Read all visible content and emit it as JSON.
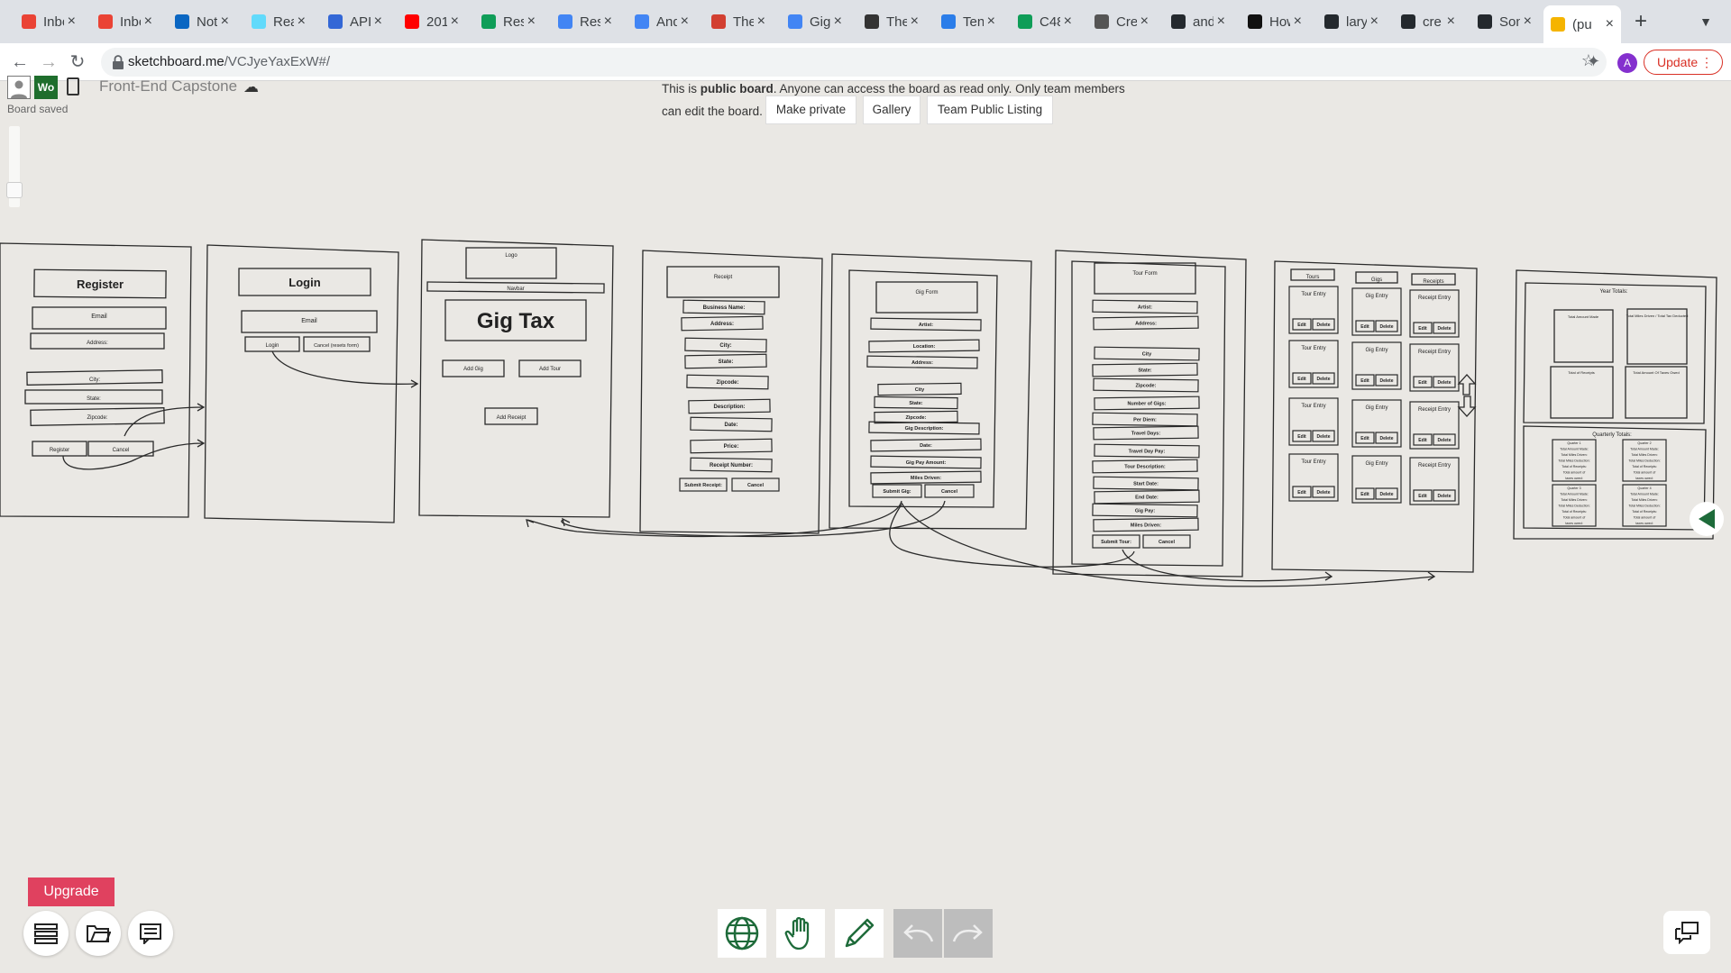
{
  "tabs": [
    {
      "title": "Inbox",
      "favicon": "gmail-icon",
      "color": "#ea4335"
    },
    {
      "title": "Inbox",
      "favicon": "gmail-icon",
      "color": "#ea4335"
    },
    {
      "title": "Noti",
      "favicon": "linkedin-icon",
      "color": "#0a66c2"
    },
    {
      "title": "Rea",
      "favicon": "react-icon",
      "color": "#61dafb"
    },
    {
      "title": "API",
      "favicon": "api-icon",
      "color": "#3367d6"
    },
    {
      "title": "201",
      "favicon": "youtube-icon",
      "color": "#ff0000"
    },
    {
      "title": "Res",
      "favicon": "drive-icon",
      "color": "#0f9d58"
    },
    {
      "title": "Res",
      "favicon": "docs-icon",
      "color": "#4285f4"
    },
    {
      "title": "And",
      "favicon": "docs-icon",
      "color": "#4285f4"
    },
    {
      "title": "The",
      "favicon": "flame-icon",
      "color": "#d23f31"
    },
    {
      "title": "Gig",
      "favicon": "docs-icon",
      "color": "#4285f4"
    },
    {
      "title": "The",
      "favicon": "book-icon",
      "color": "#333333"
    },
    {
      "title": "Ten",
      "favicon": "c-icon",
      "color": "#2b7de9"
    },
    {
      "title": "C48",
      "favicon": "drive-icon",
      "color": "#0f9d58"
    },
    {
      "title": "Cre",
      "favicon": "globe-icon",
      "color": "#555555"
    },
    {
      "title": "and",
      "favicon": "github-icon",
      "color": "#24292e"
    },
    {
      "title": "How",
      "favicon": "lambda-icon",
      "color": "#111111"
    },
    {
      "title": "lary",
      "favicon": "github-icon",
      "color": "#24292e"
    },
    {
      "title": "cre",
      "favicon": "github-icon",
      "color": "#24292e"
    },
    {
      "title": "Son",
      "favicon": "github-icon",
      "color": "#24292e"
    },
    {
      "title": "(pu",
      "favicon": "sketchboard-icon",
      "color": "#f5b400",
      "active": true
    }
  ],
  "browser": {
    "url_domain": "sketchboard.me",
    "url_path": "/VCJyeYaxExW#/",
    "update_label": "Update",
    "profile_initial": "A"
  },
  "app": {
    "workspace_badge": "Wo",
    "board_title": "Front-End Capstone",
    "saved_status": "Board saved",
    "notice_bold": "public board",
    "notice_pre": "This is ",
    "notice_post": ". Anyone can access the board as read only. Only team members can edit the board.",
    "make_private": "Make private",
    "gallery": "Gallery",
    "team_listing": "Team Public Listing",
    "upgrade": "Upgrade"
  },
  "wireframes": {
    "register": {
      "title": "Register",
      "fields": [
        "Email",
        "Address:",
        "City:",
        "State:",
        "Zipcode:"
      ],
      "buttons": [
        "Register",
        "Cancel"
      ]
    },
    "login": {
      "title": "Login",
      "fields": [
        "Email"
      ],
      "buttons": [
        "Login",
        "Cancel (resets form)"
      ]
    },
    "home": {
      "logo": "Logo",
      "navbar": "Navbar",
      "title": "Gig Tax",
      "buttons": [
        "Add Gig",
        "Add Tour",
        "Add Receipt"
      ]
    },
    "receipt": {
      "title": "Receipt",
      "fields": [
        "Business Name:",
        "Address:",
        "City:",
        "State:",
        "Zipcode:",
        "Description:",
        "Date:",
        "Price:",
        "Receipt Number:"
      ],
      "buttons": [
        "Submit Receipt:",
        "Cancel"
      ]
    },
    "gig_form": {
      "title": "Gig Form",
      "fields": [
        "Artist:",
        "Location:",
        "Address:",
        "City",
        "State:",
        "Zipcode:",
        "Gig Description:",
        "Date:",
        "Gig Pay Amount:",
        "Miles Driven:"
      ],
      "buttons": [
        "Submit Gig:",
        "Cancel"
      ]
    },
    "tour_form": {
      "title": "Tour Form",
      "fields": [
        "Artist:",
        "Address:",
        "City",
        "State:",
        "Zipcode:",
        "Number of Gigs:",
        "Per Diem:",
        "Travel Days:",
        "Travel Day Pay:",
        "Tour Description:",
        "Start Date:",
        "End Date:",
        "Gig Pay:",
        "Miles Driven:"
      ],
      "buttons": [
        "Submit Tour:",
        "Cancel"
      ]
    },
    "list": {
      "tabs": [
        "Tours",
        "Gigs",
        "Receipts"
      ],
      "columns": [
        "Tour Entry",
        "Gig Entry",
        "Receipt Entry"
      ],
      "edit": "Edit",
      "delete": "Delete"
    },
    "totals": {
      "title": "Year Totals:",
      "boxes": [
        "Total Amount Made",
        "Total Miles Driven / Total Tax Deducted",
        "Total of Receipts",
        "Total Amount Of Taxes Owed"
      ],
      "quarterly_title": "Quarterly Totals:",
      "quarters": [
        "Quarter 1",
        "Quarter 2",
        "Quarter 3",
        "Quarter 4"
      ],
      "quarter_lines": [
        "Total Amount Made:",
        "Total Miles Driven:",
        "Total Miles Deduction:",
        "Total of Receipts:",
        "Total amount of",
        "taxes owed:"
      ]
    }
  },
  "tools": {
    "globe": "globe-icon",
    "hand": "hand-icon",
    "pencil": "pencil-icon",
    "undo": "undo-icon",
    "redo": "redo-icon"
  }
}
